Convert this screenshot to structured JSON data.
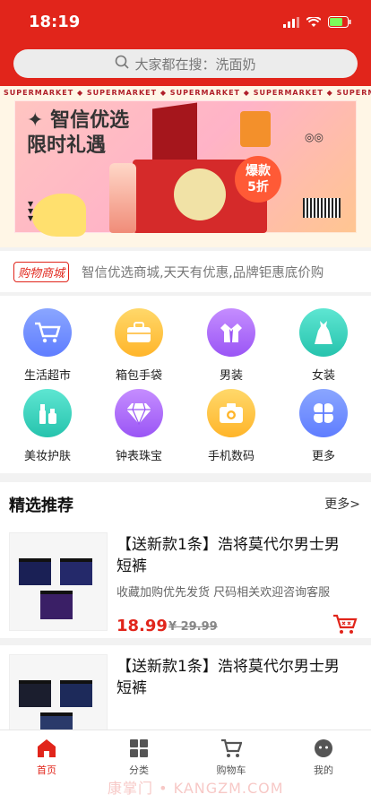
{
  "status_bar": {
    "time": "18:19"
  },
  "search": {
    "placeholder": "大家都在搜：洗面奶",
    "icon": "search-icon"
  },
  "banner": {
    "strip_text": "SUPERMARKET ◆ SUPERMARKET ◆ SUPERMARKET ◆ SUPERMARKET ◆ SUPERMARKET ◆",
    "title_line1": "✦ 智信优选",
    "title_line2": "限时礼遇",
    "badge_line1": "爆款",
    "badge_line2": "5折"
  },
  "notice": {
    "tag": "购物商城",
    "text": "智信优选商城,天天有优惠,品牌钜惠底价购"
  },
  "categories": [
    {
      "label": "生活超市",
      "icon": "cart-icon",
      "color": "#6c8cff"
    },
    {
      "label": "箱包手袋",
      "icon": "briefcase-icon",
      "color": "#ffc23a"
    },
    {
      "label": "男装",
      "icon": "suit-icon",
      "color": "#b06cff"
    },
    {
      "label": "女装",
      "icon": "dress-icon",
      "color": "#3fd6c0"
    },
    {
      "label": "美妆护肤",
      "icon": "cosmetics-icon",
      "color": "#3fd6c0"
    },
    {
      "label": "钟表珠宝",
      "icon": "diamond-icon",
      "color": "#b06cff"
    },
    {
      "label": "手机数码",
      "icon": "camera-icon",
      "color": "#ffc23a"
    },
    {
      "label": "更多",
      "icon": "clover-icon",
      "color": "#6c8cff"
    }
  ],
  "recommend": {
    "title": "精选推荐",
    "more": "更多>",
    "products": [
      {
        "title": "【送新款1条】浩将莫代尔男士男短裤",
        "desc": "收藏加购优先发货 尺码相关欢迎咨询客服",
        "price": "18.99",
        "old_price": "¥ 29.99"
      },
      {
        "title": "【送新款1条】浩将莫代尔男士男短裤"
      }
    ]
  },
  "tabbar": [
    {
      "label": "首页",
      "icon": "home-icon",
      "active": true
    },
    {
      "label": "分类",
      "icon": "grid-icon"
    },
    {
      "label": "购物车",
      "icon": "cart-icon"
    },
    {
      "label": "我的",
      "icon": "chat-face-icon"
    }
  ],
  "watermark": "康掌门 • KANGZM.COM",
  "colors": {
    "brand": "#e1251b"
  }
}
